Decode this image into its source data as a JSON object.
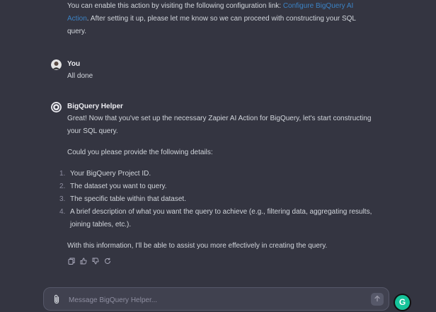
{
  "intro_message": {
    "part1": "You can enable this action by visiting the following configuration link: ",
    "link_text": "Configure BigQuery AI Action",
    "part2": ". After setting it up, please let me know so we can proceed with constructing your SQL query."
  },
  "user_turn": {
    "sender": "You",
    "text": "All done"
  },
  "assistant_turn": {
    "sender": "BigQuery Helper",
    "intro": "Great! Now that you've set up the necessary Zapier AI Action for BigQuery, let's start constructing your SQL query.",
    "ask": "Could you please provide the following details:",
    "items": [
      {
        "num": "1.",
        "text": "Your BigQuery Project ID."
      },
      {
        "num": "2.",
        "text": "The dataset you want to query."
      },
      {
        "num": "3.",
        "text": "The specific table within that dataset."
      },
      {
        "num": "4.",
        "text": "A brief description of what you want the query to achieve (e.g., filtering data, aggregating results, joining tables, etc.)."
      }
    ],
    "closing": "With this information, I'll be able to assist you more effectively in creating the query."
  },
  "composer": {
    "placeholder": "Message BigQuery Helper..."
  },
  "icons": {
    "copy": "copy-icon",
    "thumbs_up": "thumbs-up-icon",
    "thumbs_down": "thumbs-down-icon",
    "regenerate": "regenerate-icon",
    "attach": "paperclip-icon",
    "send": "arrow-up-icon"
  },
  "grammarly": {
    "label": "G",
    "color": "#15c39a"
  }
}
